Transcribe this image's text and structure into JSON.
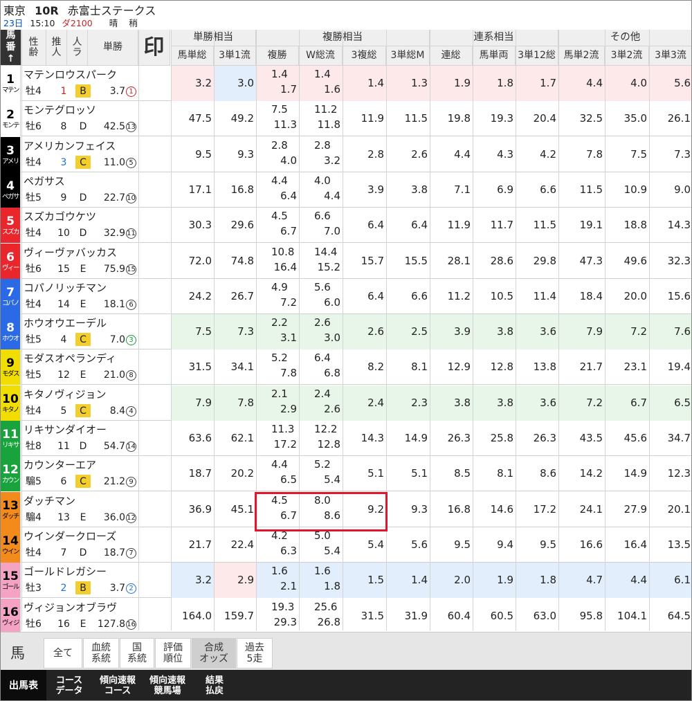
{
  "race": {
    "venue": "東京",
    "race_number": "10R",
    "race_name": "赤富士ステークス",
    "date": "23日",
    "time": "15:10",
    "course": "ダ2100",
    "weather": "晴",
    "going": "稍"
  },
  "headers": {
    "num": "馬番↑",
    "sexage": "性齢",
    "rec": "推人",
    "pop": "人ラ",
    "win": "単勝",
    "mark": "印",
    "groups": [
      "単勝相当",
      "複勝相当",
      "連系相当",
      "その他"
    ],
    "cols": [
      "馬単総",
      "3単1流",
      "複勝",
      "W総流",
      "3複総",
      "3単総M",
      "連総",
      "馬単両",
      "3単12総",
      "馬単2流",
      "3単2流",
      "3単3流"
    ]
  },
  "horses": [
    {
      "num": "1",
      "short": "マテン",
      "name": "マテンロウスパーク",
      "sexage": "牡4",
      "pop": "1",
      "rank": "B",
      "odds": "3.7",
      "order": "1",
      "v": [
        "3.2",
        "3.0",
        "1.4",
        "1.7",
        "1.4",
        "1.6",
        "1.4",
        "1.3",
        "1.9",
        "1.8",
        "1.7",
        "4.4",
        "4.0",
        "5.6"
      ]
    },
    {
      "num": "2",
      "short": "モンテ",
      "name": "モンテグロッソ",
      "sexage": "牡6",
      "pop": "8",
      "rank": "D",
      "odds": "42.5",
      "order": "13",
      "v": [
        "47.5",
        "49.2",
        "7.5",
        "11.3",
        "11.2",
        "11.8",
        "11.9",
        "11.5",
        "19.8",
        "19.3",
        "20.4",
        "32.5",
        "35.0",
        "26.1"
      ]
    },
    {
      "num": "3",
      "short": "アメリ",
      "name": "アメリカンフェイス",
      "sexage": "牡4",
      "pop": "3",
      "rank": "C",
      "odds": "11.0",
      "order": "5",
      "v": [
        "9.5",
        "9.3",
        "2.8",
        "4.0",
        "2.8",
        "3.2",
        "2.8",
        "2.6",
        "4.4",
        "4.3",
        "4.2",
        "7.8",
        "7.5",
        "7.3"
      ]
    },
    {
      "num": "4",
      "short": "ペガサ",
      "name": "ペガサス",
      "sexage": "牡5",
      "pop": "9",
      "rank": "D",
      "odds": "22.7",
      "order": "10",
      "v": [
        "17.1",
        "16.8",
        "4.4",
        "6.4",
        "4.0",
        "4.4",
        "3.9",
        "3.8",
        "7.1",
        "6.9",
        "6.6",
        "11.5",
        "10.9",
        "9.0"
      ]
    },
    {
      "num": "5",
      "short": "スズカ",
      "name": "スズカゴウケツ",
      "sexage": "牡4",
      "pop": "10",
      "rank": "D",
      "odds": "32.9",
      "order": "11",
      "v": [
        "30.3",
        "29.6",
        "4.5",
        "6.7",
        "6.6",
        "7.0",
        "6.4",
        "6.4",
        "11.9",
        "11.7",
        "11.5",
        "19.1",
        "18.8",
        "14.3"
      ]
    },
    {
      "num": "6",
      "short": "ヴィー",
      "name": "ヴィーヴァバッカス",
      "sexage": "牡6",
      "pop": "15",
      "rank": "E",
      "odds": "75.9",
      "order": "15",
      "v": [
        "72.0",
        "74.8",
        "10.8",
        "16.4",
        "14.4",
        "15.2",
        "15.7",
        "15.5",
        "28.1",
        "28.6",
        "29.8",
        "47.3",
        "49.6",
        "32.3"
      ]
    },
    {
      "num": "7",
      "short": "コパノ",
      "name": "コパノリッチマン",
      "sexage": "牡4",
      "pop": "14",
      "rank": "E",
      "odds": "18.1",
      "order": "6",
      "v": [
        "24.2",
        "26.7",
        "4.9",
        "7.2",
        "5.6",
        "6.0",
        "6.4",
        "6.6",
        "11.2",
        "10.5",
        "11.4",
        "18.4",
        "20.0",
        "15.6"
      ]
    },
    {
      "num": "8",
      "short": "ホウオ",
      "name": "ホウオウエーデル",
      "sexage": "牡5",
      "pop": "4",
      "rank": "C",
      "odds": "7.0",
      "order": "3",
      "v": [
        "7.5",
        "7.3",
        "2.2",
        "3.1",
        "2.6",
        "3.0",
        "2.6",
        "2.5",
        "3.9",
        "3.8",
        "3.6",
        "7.9",
        "7.2",
        "7.6"
      ]
    },
    {
      "num": "9",
      "short": "モダス",
      "name": "モダスオペランディ",
      "sexage": "牡5",
      "pop": "12",
      "rank": "E",
      "odds": "21.0",
      "order": "8",
      "v": [
        "31.5",
        "34.1",
        "5.2",
        "7.8",
        "6.4",
        "6.8",
        "8.2",
        "8.1",
        "12.9",
        "12.8",
        "13.8",
        "21.7",
        "23.1",
        "19.4"
      ]
    },
    {
      "num": "10",
      "short": "キタノ",
      "name": "キタノヴィジョン",
      "sexage": "牡4",
      "pop": "5",
      "rank": "C",
      "odds": "8.4",
      "order": "4",
      "v": [
        "7.9",
        "7.8",
        "2.1",
        "2.9",
        "2.4",
        "2.6",
        "2.4",
        "2.3",
        "3.8",
        "3.8",
        "3.6",
        "7.2",
        "6.7",
        "6.5"
      ]
    },
    {
      "num": "11",
      "short": "リキサ",
      "name": "リキサンダイオー",
      "sexage": "牡8",
      "pop": "11",
      "rank": "D",
      "odds": "54.7",
      "order": "14",
      "v": [
        "63.6",
        "62.1",
        "11.3",
        "17.2",
        "12.2",
        "12.8",
        "14.3",
        "14.9",
        "26.3",
        "25.8",
        "26.3",
        "43.5",
        "45.6",
        "34.7"
      ]
    },
    {
      "num": "12",
      "short": "カウン",
      "name": "カウンターエア",
      "sexage": "騸5",
      "pop": "6",
      "rank": "C",
      "odds": "21.2",
      "order": "9",
      "v": [
        "18.7",
        "20.2",
        "4.4",
        "6.5",
        "5.2",
        "5.4",
        "5.1",
        "5.1",
        "8.5",
        "8.1",
        "8.6",
        "14.2",
        "14.9",
        "12.3"
      ]
    },
    {
      "num": "13",
      "short": "ダッチ",
      "name": "ダッチマン",
      "sexage": "騸4",
      "pop": "13",
      "rank": "E",
      "odds": "36.0",
      "order": "12",
      "v": [
        "36.9",
        "45.1",
        "4.5",
        "6.7",
        "8.0",
        "8.6",
        "9.2",
        "9.3",
        "16.8",
        "14.6",
        "17.2",
        "24.1",
        "27.9",
        "20.1"
      ]
    },
    {
      "num": "14",
      "short": "ウイン",
      "name": "ウインダークローズ",
      "sexage": "牡4",
      "pop": "7",
      "rank": "D",
      "odds": "18.7",
      "order": "7",
      "v": [
        "21.7",
        "22.4",
        "4.2",
        "6.3",
        "5.0",
        "5.4",
        "5.4",
        "5.6",
        "9.5",
        "9.4",
        "9.5",
        "16.6",
        "16.4",
        "13.5"
      ]
    },
    {
      "num": "15",
      "short": "ゴール",
      "name": "ゴールドレガシー",
      "sexage": "牡3",
      "pop": "2",
      "rank": "B",
      "odds": "3.7",
      "order": "2",
      "v": [
        "3.2",
        "2.9",
        "1.6",
        "2.1",
        "1.6",
        "1.8",
        "1.5",
        "1.4",
        "2.0",
        "1.9",
        "1.8",
        "4.7",
        "4.4",
        "6.1"
      ]
    },
    {
      "num": "16",
      "short": "ヴィジ",
      "name": "ヴィジョンオブラヴ",
      "sexage": "牡6",
      "pop": "16",
      "rank": "E",
      "odds": "127.8",
      "order": "16",
      "v": [
        "164.0",
        "159.7",
        "19.3",
        "29.3",
        "25.6",
        "26.8",
        "31.5",
        "31.9",
        "60.4",
        "60.5",
        "63.0",
        "95.8",
        "104.1",
        "64.5"
      ]
    }
  ],
  "subtabs": {
    "horse": "馬",
    "items": [
      {
        "l1": "全て",
        "l2": ""
      },
      {
        "l1": "血統",
        "l2": "系統"
      },
      {
        "l1": "国",
        "l2": "系統"
      },
      {
        "l1": "評価",
        "l2": "順位"
      },
      {
        "l1": "合成",
        "l2": "オッズ"
      },
      {
        "l1": "過去",
        "l2": "5走"
      }
    ]
  },
  "bottom_nav": [
    {
      "l1": "出馬表",
      "l2": ""
    },
    {
      "l1": "コース",
      "l2": "データ"
    },
    {
      "l1": "傾向速報",
      "l2": "コース"
    },
    {
      "l1": "傾向速報",
      "l2": "競馬場"
    },
    {
      "l1": "結果",
      "l2": "払戻"
    }
  ],
  "colors": {
    "gate": [
      "#ffffff",
      "#000000",
      "#e8262c",
      "#2a6ae6",
      "#f2dd00",
      "#18a33c",
      "#f28a1c",
      "#f5a3c4"
    ],
    "highlight": "#e0162e",
    "rank_bg": "#f3ce2e"
  }
}
